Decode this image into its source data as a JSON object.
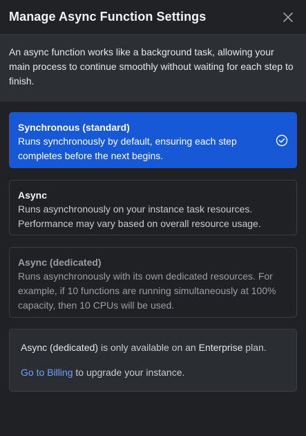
{
  "dialog": {
    "title": "Manage Async Function Settings",
    "close_icon": "close-icon",
    "intro": "An async function works like a background task, allowing your main process to continue smoothly without waiting for each step to finish."
  },
  "options": [
    {
      "title": "Synchronous (standard)",
      "description": "Runs synchronously by default, ensuring each step completes before the next begins.",
      "selected": true,
      "icon": "check-circle-icon"
    },
    {
      "title": "Async",
      "description": "Runs asynchronously on your instance task resources. Performance may vary based on overall resource usage.",
      "selected": false
    },
    {
      "title": "Async (dedicated)",
      "description": "Runs asynchronously with its own dedicated resources. For example, if 10 functions are running simultaneously at 100% capacity, then 10 CPUs will be used.",
      "selected": false,
      "disabled": true
    }
  ],
  "notice": {
    "part1": "Async (dedicated)",
    "part2": " is only available on an ",
    "part3": "Enterprise",
    "part4": " plan.",
    "link": "Go to Billing",
    "link_suffix": " to upgrade your instance."
  },
  "colors": {
    "accent": "#1758d6",
    "link": "#6ea1ff",
    "background": "#1f2125"
  }
}
